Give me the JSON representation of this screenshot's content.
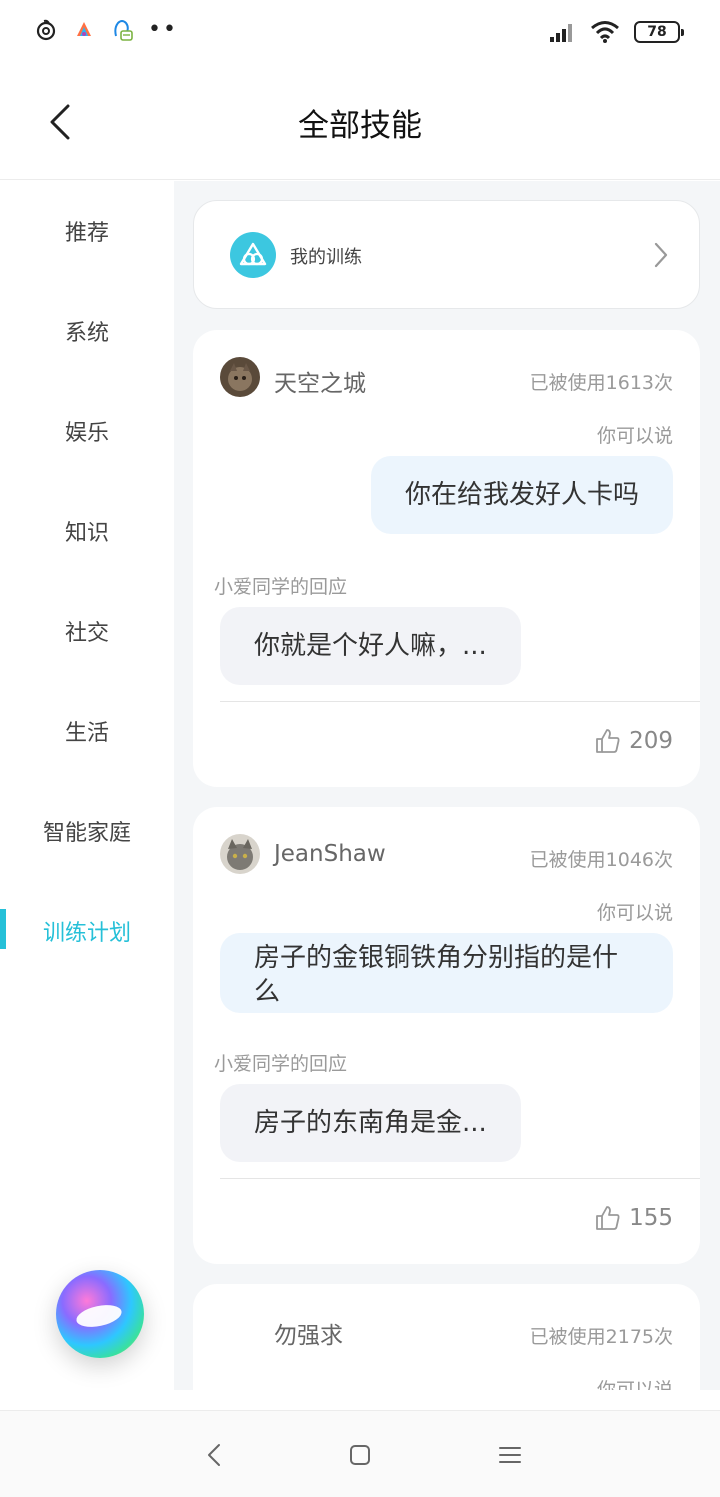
{
  "status_bar": {
    "battery": "78",
    "left_icons": [
      "netease-music-icon",
      "app-icon",
      "qq-notification-icon",
      "more-dots"
    ]
  },
  "header": {
    "title": "全部技能"
  },
  "sidebar": {
    "items": [
      {
        "label": "推荐"
      },
      {
        "label": "系统"
      },
      {
        "label": "娱乐"
      },
      {
        "label": "知识"
      },
      {
        "label": "社交"
      },
      {
        "label": "生活"
      },
      {
        "label": "智能家庭"
      },
      {
        "label": "训练计划"
      }
    ],
    "active_index": 7
  },
  "training_entry": {
    "label": "我的训练"
  },
  "cards": [
    {
      "author": "天空之城",
      "usage": "已被使用1613次",
      "you_can_say_label": "你可以说",
      "utterance": "你在给我发好人卡吗",
      "reply_label": "小爱同学的回应",
      "reply": "你就是个好人嘛，...",
      "likes": "209"
    },
    {
      "author": "JeanShaw",
      "usage": "已被使用1046次",
      "you_can_say_label": "你可以说",
      "utterance": "房子的金银铜铁角分别指的是什么",
      "reply_label": "小爱同学的回应",
      "reply": "房子的东南角是金...",
      "likes": "155"
    },
    {
      "author": "勿强求",
      "usage": "已被使用2175次",
      "you_can_say_label": "你可以说"
    }
  ],
  "colors": {
    "accent": "#26c0d8",
    "user_bubble": "#ecf5fd",
    "reply_bubble": "#f2f3f7",
    "background": "#f4f6f8"
  }
}
